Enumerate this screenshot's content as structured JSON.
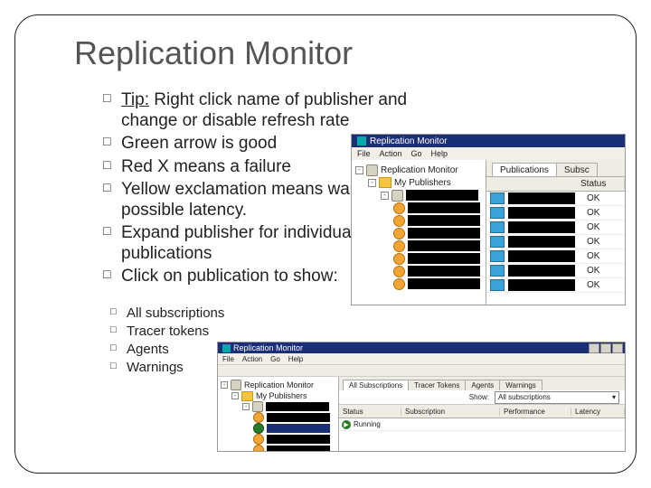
{
  "title": "Replication Monitor",
  "bullets": [
    {
      "prefix": "Tip:",
      "text": " Right click name of publisher and change or disable refresh rate"
    },
    {
      "text": "Green arrow is good"
    },
    {
      "text": "Red X means a failure"
    },
    {
      "text": "Yellow exclamation means warning, possible latency."
    },
    {
      "text": "Expand publisher for individual publications"
    },
    {
      "text": "Click on publication to show:"
    }
  ],
  "sub_bullets": [
    "All subscriptions",
    "Tracer tokens",
    "Agents",
    "Warnings"
  ],
  "shot1": {
    "window_title": "Replication Monitor",
    "menu": [
      "File",
      "Action",
      "Go",
      "Help"
    ],
    "tree_root": "Replication Monitor",
    "tree_group": "My Publishers",
    "tabs": [
      "Publications",
      "Subsc"
    ],
    "status_header": "Status",
    "status_values": [
      "OK",
      "OK",
      "OK",
      "OK",
      "OK",
      "OK",
      "OK"
    ]
  },
  "shot2": {
    "window_title": "Replication Monitor",
    "menu": [
      "File",
      "Action",
      "Go",
      "Help"
    ],
    "tree_root": "Replication Monitor",
    "tree_group": "My Publishers",
    "tabs": [
      "All Subscriptions",
      "Tracer Tokens",
      "Agents",
      "Warnings"
    ],
    "filter_label": "Show:",
    "filter_value": "All subscriptions",
    "columns": [
      "Status",
      "Subscription",
      "Performance",
      "Latency"
    ],
    "row_status_icon": "▶",
    "row_status": "Running"
  }
}
